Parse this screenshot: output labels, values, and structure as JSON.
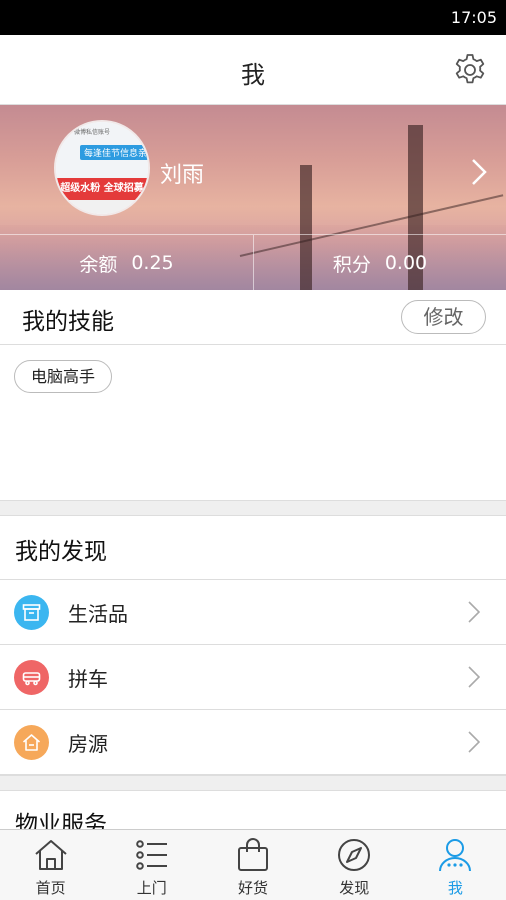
{
  "status_bar": {
    "time": "17:05"
  },
  "header": {
    "title": "我",
    "settings_icon": "gear-icon"
  },
  "profile": {
    "avatar_text": {
      "top_small": "微博私信账号",
      "label": "每逢佳节信息亲",
      "band": "超级水粉 全球招募"
    },
    "name": "刘雨",
    "balance_label": "余额",
    "balance_value": "0.25",
    "points_label": "积分",
    "points_value": "0.00"
  },
  "skills": {
    "title": "我的技能",
    "edit_label": "修改",
    "tags": [
      "电脑高手"
    ]
  },
  "discover": {
    "title": "我的发现",
    "items": [
      {
        "label": "生活品",
        "icon": "box-icon",
        "color": "#3bb6f0"
      },
      {
        "label": "拼车",
        "icon": "car-icon",
        "color": "#ef6666"
      },
      {
        "label": "房源",
        "icon": "house-icon",
        "color": "#f6a85a"
      }
    ]
  },
  "property": {
    "title": "物业服务"
  },
  "tabs": [
    {
      "label": "首页",
      "icon": "home-icon",
      "active": false
    },
    {
      "label": "上门",
      "icon": "list-icon",
      "active": false
    },
    {
      "label": "好货",
      "icon": "shopping-bag-icon",
      "active": false
    },
    {
      "label": "发现",
      "icon": "compass-icon",
      "active": false
    },
    {
      "label": "我",
      "icon": "person-icon",
      "active": true
    }
  ],
  "colors": {
    "accent": "#1b9be6",
    "divider": "#dddddd",
    "gap": "#efefef"
  }
}
